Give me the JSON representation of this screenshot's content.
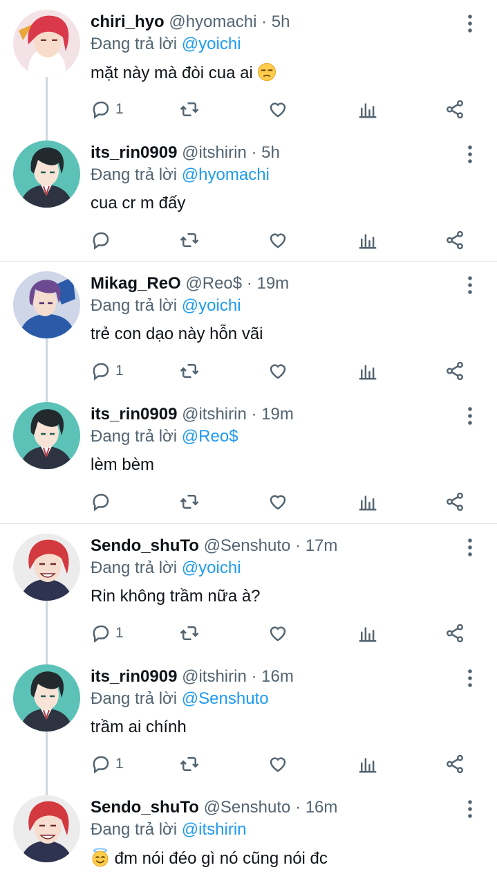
{
  "reply_prefix": "Đang trả lời",
  "separator": "·",
  "tweets": [
    {
      "name": "chiri_hyo",
      "handle": "@hyomachi",
      "time": "5h",
      "reply_to": "@yoichi",
      "text": "mặt này mà đòi cua ai",
      "emoji": "unamused-face",
      "reply_count": "1",
      "avatar": "red-hair-avatar"
    },
    {
      "name": "its_rin0909",
      "handle": "@itshirin",
      "time": "5h",
      "reply_to": "@hyomachi",
      "text": "cua cr m đấy",
      "emoji": "",
      "reply_count": "",
      "avatar": "dark-hair-teal-avatar"
    },
    {
      "name": "Mikag_ReO",
      "handle": "@Reo$",
      "time": "19m",
      "reply_to": "@yoichi",
      "text": "trẻ con dạo này hỗn vãi",
      "emoji": "",
      "reply_count": "1",
      "avatar": "purple-hair-avatar"
    },
    {
      "name": "its_rin0909",
      "handle": "@itshirin",
      "time": "19m",
      "reply_to": "@Reo$",
      "text": "lèm bèm",
      "emoji": "",
      "reply_count": "",
      "avatar": "dark-hair-teal-avatar"
    },
    {
      "name": "Sendo_shuTo",
      "handle": "@Senshuto",
      "time": "17m",
      "reply_to": "@yoichi",
      "text": "Rin không trầm nữa à?",
      "emoji": "",
      "reply_count": "1",
      "avatar": "red-hair-grin-avatar"
    },
    {
      "name": "its_rin0909",
      "handle": "@itshirin",
      "time": "16m",
      "reply_to": "@Senshuto",
      "text": "trầm ai chính",
      "emoji": "",
      "reply_count": "1",
      "avatar": "dark-hair-teal-avatar"
    },
    {
      "name": "Sendo_shuTo",
      "handle": "@Senshuto",
      "time": "16m",
      "reply_to": "@itshirin",
      "text": "đm nói đéo gì nó cũng nói đc",
      "emoji": "smiling-face-with-halo",
      "reply_count": "",
      "avatar": "red-hair-grin-avatar"
    }
  ]
}
